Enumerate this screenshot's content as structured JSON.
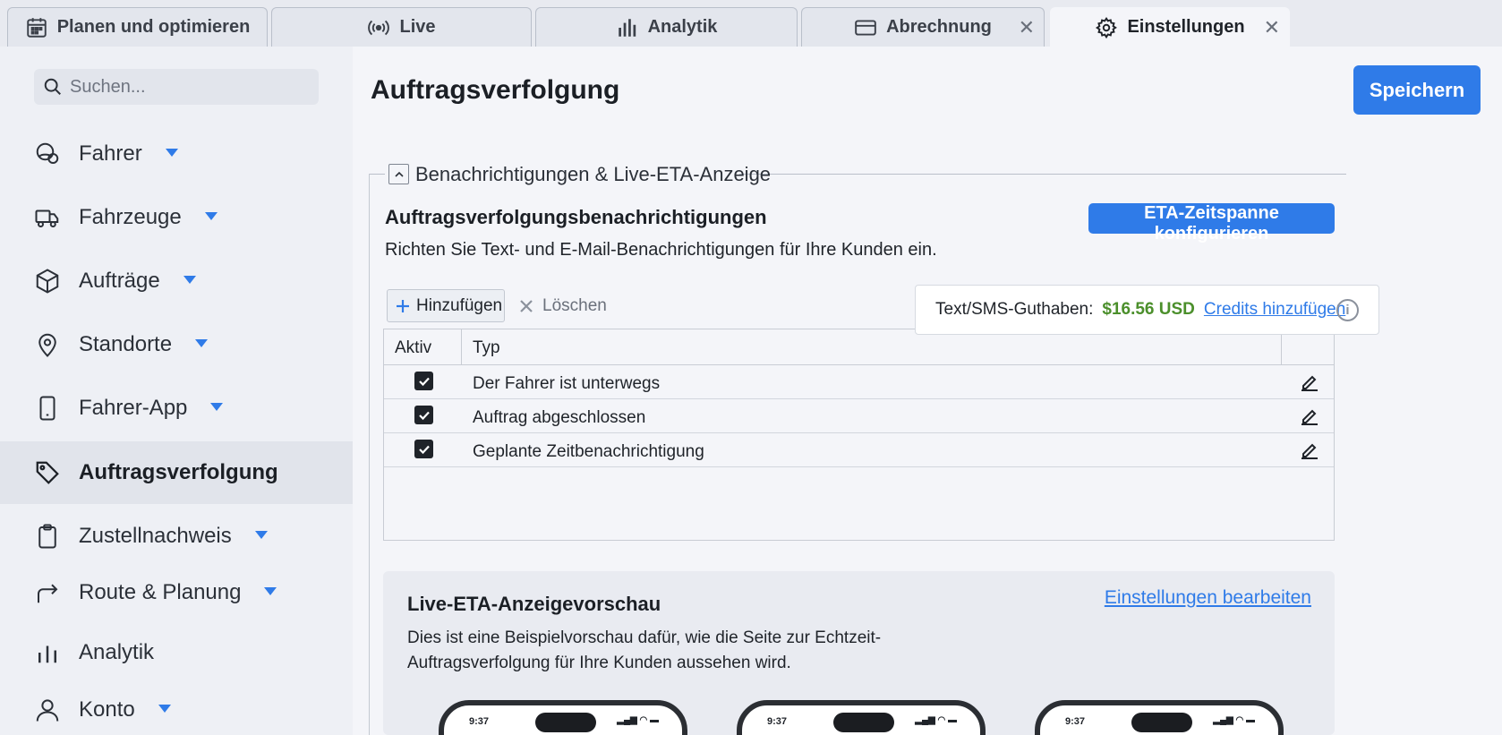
{
  "tabs": [
    {
      "label": "Planen und optimieren",
      "icon": "calendar-icon"
    },
    {
      "label": "Live",
      "icon": "broadcast-icon"
    },
    {
      "label": "Analytik",
      "icon": "bar-chart-icon"
    },
    {
      "label": "Abrechnung",
      "icon": "credit-card-icon",
      "closable": true
    },
    {
      "label": "Einstellungen",
      "icon": "gear-icon",
      "closable": true,
      "active": true
    }
  ],
  "sidebar": {
    "search_placeholder": "Suchen...",
    "items": [
      {
        "label": "Fahrer",
        "icon": "driver-icon",
        "has_dropdown": true
      },
      {
        "label": "Fahrzeuge",
        "icon": "truck-icon",
        "has_dropdown": true
      },
      {
        "label": "Aufträge",
        "icon": "box-icon",
        "has_dropdown": true
      },
      {
        "label": "Standorte",
        "icon": "location-pin-icon",
        "has_dropdown": true
      },
      {
        "label": "Fahrer-App",
        "icon": "phone-icon",
        "has_dropdown": true
      },
      {
        "label": "Auftragsverfolgung",
        "icon": "tag-icon",
        "active": true
      },
      {
        "label": "Zustellnachweis",
        "icon": "clipboard-icon",
        "has_dropdown": true
      },
      {
        "label": "Route & Planung",
        "icon": "route-arrow-icon",
        "has_dropdown": true
      },
      {
        "label": "Analytik",
        "icon": "bar-chart-icon"
      },
      {
        "label": "Konto",
        "icon": "user-icon",
        "has_dropdown": true
      }
    ]
  },
  "main": {
    "title": "Auftragsverfolgung",
    "save_label": "Speichern",
    "section_legend": "Benachrichtigungen & Live-ETA-Anzeige",
    "notifications": {
      "title": "Auftragsverfolgungsbenachrichtigungen",
      "description": "Richten Sie Text- und E-Mail-Benachrichtigungen für Ihre Kunden ein.",
      "eta_button": "ETA-Zeitspanne konfigurieren",
      "add_label": "Hinzufügen",
      "delete_label": "Löschen",
      "credits": {
        "label": "Text/SMS-Guthaben:",
        "amount": "$16.56 USD",
        "link": "Credits hinzufügen"
      },
      "columns": [
        "Aktiv",
        "Typ"
      ],
      "rows": [
        {
          "active": true,
          "type": "Der Fahrer ist unterwegs"
        },
        {
          "active": true,
          "type": "Auftrag abgeschlossen"
        },
        {
          "active": true,
          "type": "Geplante Zeitbenachrichtigung"
        }
      ]
    },
    "preview": {
      "title": "Live-ETA-Anzeigevorschau",
      "edit_link": "Einstellungen bearbeiten",
      "description": "Dies ist eine Beispielvorschau dafür, wie die Seite zur Echtzeit-Auftragsverfolgung für Ihre Kunden aussehen wird.",
      "phone_time": "9:37"
    }
  },
  "colors": {
    "accent": "#2f7be8",
    "credit_amount": "#4b8f2b",
    "sidebar_bg": "#eef0f5",
    "active_item_bg": "#e1e4eb"
  }
}
